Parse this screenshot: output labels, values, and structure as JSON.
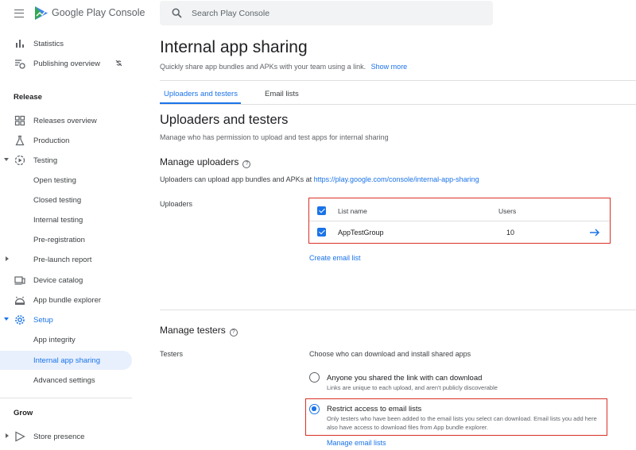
{
  "brand": {
    "google": "Google",
    "product": "Play Console"
  },
  "search": {
    "placeholder": "Search Play Console"
  },
  "sidebar": {
    "items_top": [
      {
        "label": "Statistics",
        "icon": "bar-chart-icon"
      },
      {
        "label": "Publishing overview",
        "icon": "publishing-icon"
      }
    ],
    "release_heading": "Release",
    "release_items": [
      {
        "label": "Releases overview",
        "icon": "dashboard-icon"
      },
      {
        "label": "Production",
        "icon": "flask-icon"
      },
      {
        "label": "Testing",
        "icon": "play-circle-icon"
      },
      {
        "label": "Open testing"
      },
      {
        "label": "Closed testing"
      },
      {
        "label": "Internal testing"
      },
      {
        "label": "Pre-registration"
      },
      {
        "label": "Pre-launch report"
      },
      {
        "label": "Device catalog",
        "icon": "devices-icon"
      },
      {
        "label": "App bundle explorer",
        "icon": "android-icon"
      },
      {
        "label": "Setup",
        "icon": "gear-icon"
      },
      {
        "label": "App integrity"
      },
      {
        "label": "Internal app sharing"
      },
      {
        "label": "Advanced settings"
      }
    ],
    "grow_heading": "Grow",
    "grow_items": [
      {
        "label": "Store presence",
        "icon": "play-icon"
      }
    ]
  },
  "main": {
    "title": "Internal app sharing",
    "subtitle": "Quickly share app bundles and APKs with your team using a link.",
    "show_more": "Show more",
    "tabs": [
      {
        "label": "Uploaders and testers"
      },
      {
        "label": "Email lists"
      }
    ],
    "section_title": "Uploaders and testers",
    "section_subtitle": "Manage who has permission to upload and test apps for internal sharing",
    "manage_uploaders": {
      "heading": "Manage uploaders",
      "help": "?",
      "desc_prefix": "Uploaders can upload app bundles and APKs at",
      "desc_link": "https://play.google.com/console/internal-app-sharing",
      "field_label": "Uploaders",
      "table": {
        "headers": {
          "name": "List name",
          "users": "Users"
        },
        "rows": [
          {
            "name": "AppTestGroup",
            "users": "10",
            "checked": true
          }
        ]
      },
      "create_link": "Create email list"
    },
    "manage_testers": {
      "heading": "Manage testers",
      "help": "?",
      "field_label": "Testers",
      "intro": "Choose who can download and install shared apps",
      "options": [
        {
          "title": "Anyone you shared the link with can download",
          "desc": "Links are unique to each upload, and aren't publicly discoverable",
          "selected": false
        },
        {
          "title": "Restrict access to email lists",
          "desc": "Only testers who have been added to the email lists you select can download. Email lists you add here also have access to download files from App bundle explorer.",
          "selected": true
        }
      ],
      "manage_link": "Manage email lists"
    }
  },
  "colors": {
    "accent": "#1a73e8",
    "highlight": "#d93025",
    "active_bg": "#e8f0fe"
  }
}
